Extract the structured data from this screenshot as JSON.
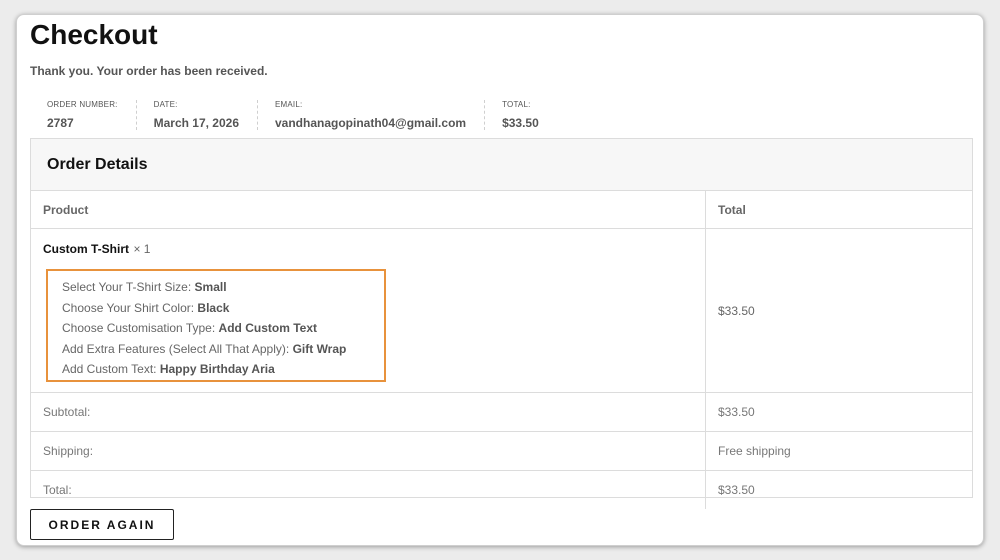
{
  "page": {
    "title": "Checkout",
    "thank_you": "Thank you. Your order has been received."
  },
  "overview": [
    {
      "label": "ORDER NUMBER:",
      "value": "2787"
    },
    {
      "label": "DATE:",
      "value": "March 17, 2026"
    },
    {
      "label": "EMAIL:",
      "value": "vandhanagopinath04@gmail.com"
    },
    {
      "label": "TOTAL:",
      "value": "$33.50"
    }
  ],
  "order_details": {
    "heading": "Order Details",
    "columns": {
      "product": "Product",
      "total": "Total"
    },
    "item": {
      "name": "Custom T-Shirt",
      "quantity": "× 1",
      "total": "$33.50",
      "meta": [
        {
          "label": "Select Your T-Shirt Size:",
          "value": "Small"
        },
        {
          "label": "Choose Your Shirt Color:",
          "value": "Black"
        },
        {
          "label": "Choose Customisation Type:",
          "value": "Add Custom Text"
        },
        {
          "label": "Add Extra Features (Select All That Apply):",
          "value": "Gift Wrap"
        },
        {
          "label": "Add Custom Text:",
          "value": "Happy Birthday Aria"
        }
      ]
    },
    "totals": [
      {
        "label": "Subtotal:",
        "value": "$33.50"
      },
      {
        "label": "Shipping:",
        "value": "Free shipping"
      },
      {
        "label": "Total:",
        "value": "$33.50"
      }
    ]
  },
  "actions": {
    "order_again": "ORDER AGAIN"
  },
  "colors": {
    "highlight_border": "#e8923c"
  }
}
